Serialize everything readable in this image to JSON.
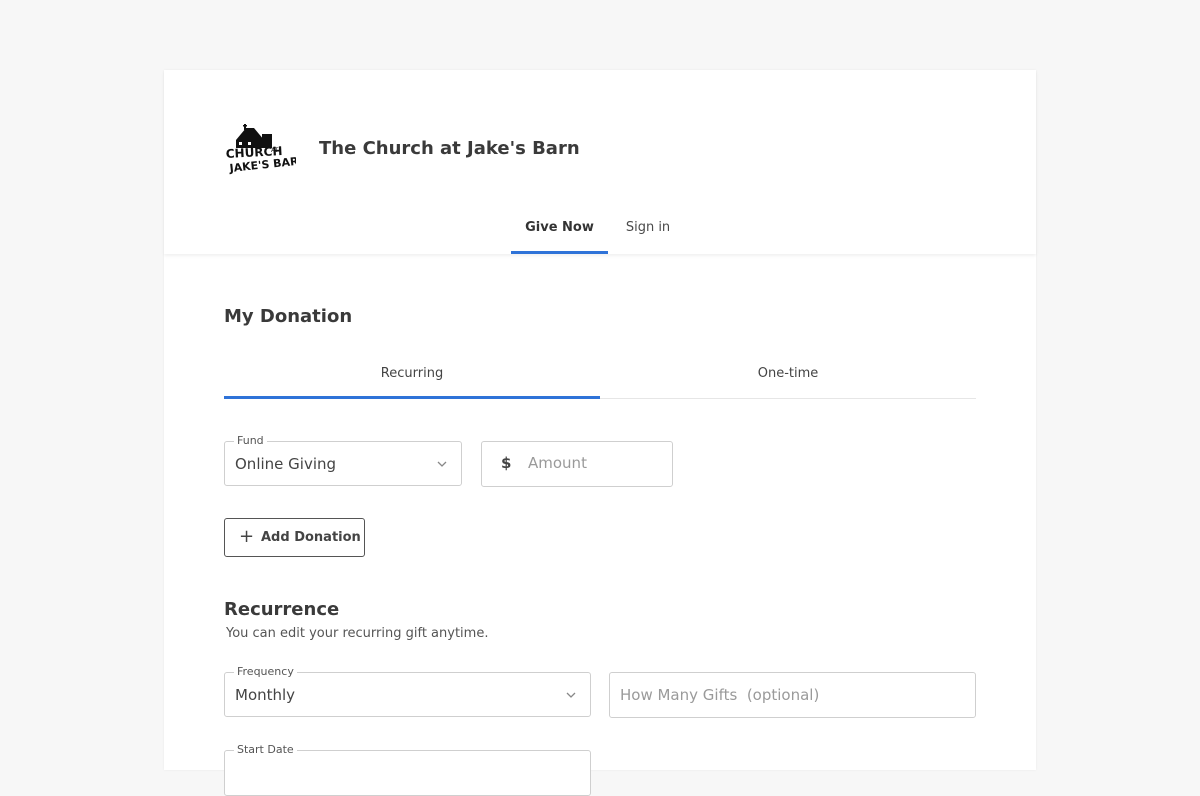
{
  "header": {
    "org_name": "The Church at Jake's Barn",
    "nav": [
      {
        "label": "Give Now",
        "active": true
      },
      {
        "label": "Sign in",
        "active": false
      }
    ],
    "accent_color": "#2f73d8"
  },
  "donation": {
    "title": "My Donation",
    "tabs": [
      {
        "label": "Recurring",
        "active": true
      },
      {
        "label": "One-time",
        "active": false
      }
    ],
    "fund": {
      "label": "Fund",
      "value": "Online Giving"
    },
    "amount": {
      "currency_symbol": "$",
      "placeholder": "Amount"
    },
    "add_button": {
      "label": "Add Donation"
    }
  },
  "recurrence": {
    "title": "Recurrence",
    "subtitle": "You can edit your recurring gift anytime.",
    "frequency": {
      "label": "Frequency",
      "value": "Monthly"
    },
    "gifts": {
      "placeholder": "How Many Gifts  (optional)"
    },
    "start_date_label": "Start Date"
  },
  "icons": {
    "chevron": "chevron-down-icon",
    "plus": "plus-icon",
    "logo": "church-barn-logo"
  }
}
